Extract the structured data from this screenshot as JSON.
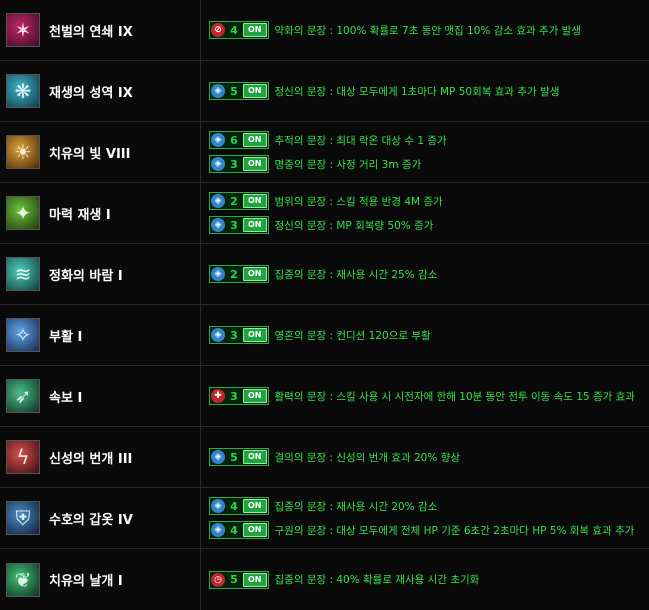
{
  "rows": [
    {
      "skill": "천벌의 연쇄 IX",
      "icon": "chain-punishment-icon",
      "icon_colors": [
        "#c3256b",
        "#3a0d22"
      ],
      "glyphs": [
        {
          "level": "4",
          "on": "ON",
          "icon": "red-slash-glyph-icon",
          "icon_color": "#c0262e",
          "desc": "약화의 문장 : 100% 확률로 7초 동안 맷집 10% 감소 효과 추가 발생"
        }
      ]
    },
    {
      "skill": "재생의 성역 IX",
      "icon": "regeneration-sanctuary-icon",
      "icon_colors": [
        "#3ab7c9",
        "#123849"
      ],
      "glyphs": [
        {
          "level": "5",
          "on": "ON",
          "icon": "blue-glyph-icon",
          "icon_color": "#2f86c8",
          "desc": "정신의 문장 : 대상 모두에게 1초마다 MP 50회복 효과 추가 발생"
        }
      ]
    },
    {
      "skill": "치유의 빛 VIII",
      "icon": "healing-light-icon",
      "icon_colors": [
        "#e0a43a",
        "#4a2a08"
      ],
      "glyphs": [
        {
          "level": "6",
          "on": "ON",
          "icon": "blue-glyph-icon",
          "icon_color": "#2f86c8",
          "desc": "추적의 문장 : 최대 락온 대상 수 1 증가"
        },
        {
          "level": "3",
          "on": "ON",
          "icon": "blue-glyph-icon",
          "icon_color": "#2f86c8",
          "desc": "명중의 문장 : 사정 거리 3m 증가"
        }
      ]
    },
    {
      "skill": "마력 재생 I",
      "icon": "mana-regeneration-icon",
      "icon_colors": [
        "#6ec23b",
        "#1f3a0c"
      ],
      "glyphs": [
        {
          "level": "2",
          "on": "ON",
          "icon": "blue-glyph-icon",
          "icon_color": "#2f86c8",
          "desc": "범위의 문장 : 스킬 적용 반경 4M 증가"
        },
        {
          "level": "3",
          "on": "ON",
          "icon": "blue-glyph-icon",
          "icon_color": "#2f86c8",
          "desc": "정신의 문장 : MP 회복량 50% 증가"
        }
      ]
    },
    {
      "skill": "정화의 바람 I",
      "icon": "purifying-wind-icon",
      "icon_colors": [
        "#4fd0c0",
        "#0f3a3a"
      ],
      "glyphs": [
        {
          "level": "2",
          "on": "ON",
          "icon": "blue-glyph-icon",
          "icon_color": "#2f86c8",
          "desc": "집중의 문장 : 재사용 시간 25% 감소"
        }
      ]
    },
    {
      "skill": "부활 I",
      "icon": "resurrection-icon",
      "icon_colors": [
        "#5fa6e8",
        "#14284a"
      ],
      "glyphs": [
        {
          "level": "3",
          "on": "ON",
          "icon": "blue-glyph-icon",
          "icon_color": "#2f86c8",
          "desc": "영혼의 문장 : 컨디션 120으로 부활"
        }
      ]
    },
    {
      "skill": "속보 I",
      "icon": "quick-step-icon",
      "icon_colors": [
        "#49c08c",
        "#0e2f22"
      ],
      "glyphs": [
        {
          "level": "3",
          "on": "ON",
          "icon": "red-cross-glyph-icon",
          "icon_color": "#c0262e",
          "desc": "활력의 문장 : 스킬 사용 시 시전자에 한해 10분 동안 전투 이동 속도 15 증가 효과"
        }
      ]
    },
    {
      "skill": "신성의 번개 III",
      "icon": "holy-lightning-icon",
      "icon_colors": [
        "#d45050",
        "#3a0c12"
      ],
      "glyphs": [
        {
          "level": "5",
          "on": "ON",
          "icon": "blue-glyph-icon",
          "icon_color": "#2f86c8",
          "desc": "결의의 문장 : 신성의 번개 효과 20% 향상"
        }
      ]
    },
    {
      "skill": "수호의 갑옷 IV",
      "icon": "guardian-armor-icon",
      "icon_colors": [
        "#4a8ec8",
        "#0e1f36"
      ],
      "glyphs": [
        {
          "level": "4",
          "on": "ON",
          "icon": "blue-glyph-icon",
          "icon_color": "#2f86c8",
          "desc": "집중의 문장 : 재사용 시간 20% 감소"
        },
        {
          "level": "4",
          "on": "ON",
          "icon": "blue-glyph-icon",
          "icon_color": "#2f86c8",
          "desc": "구원의 문장 : 대상 모두에게 전체 HP 기준 6초간 2초마다 HP 5% 회복 효과 추가"
        }
      ]
    },
    {
      "skill": "치유의 날개 I",
      "icon": "healing-wings-icon",
      "icon_colors": [
        "#42c477",
        "#0c2f1c"
      ],
      "glyphs": [
        {
          "level": "5",
          "on": "ON",
          "icon": "red-clock-glyph-icon",
          "icon_color": "#c0262e",
          "desc": "집중의 문장 : 40% 확률로 재사용 시간 초기화"
        }
      ]
    }
  ]
}
